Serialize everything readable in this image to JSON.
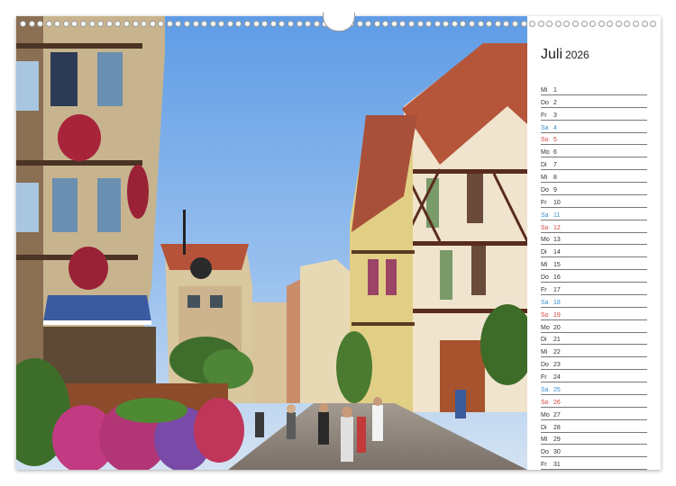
{
  "calendar": {
    "month": "Juli",
    "year": "2026",
    "days": [
      {
        "dow": "Mi",
        "num": "1",
        "type": "weekday"
      },
      {
        "dow": "Do",
        "num": "2",
        "type": "weekday"
      },
      {
        "dow": "Fr",
        "num": "3",
        "type": "weekday"
      },
      {
        "dow": "Sa",
        "num": "4",
        "type": "sa"
      },
      {
        "dow": "So",
        "num": "5",
        "type": "so"
      },
      {
        "dow": "Mo",
        "num": "6",
        "type": "weekday"
      },
      {
        "dow": "Di",
        "num": "7",
        "type": "weekday"
      },
      {
        "dow": "Mi",
        "num": "8",
        "type": "weekday"
      },
      {
        "dow": "Do",
        "num": "9",
        "type": "weekday"
      },
      {
        "dow": "Fr",
        "num": "10",
        "type": "weekday"
      },
      {
        "dow": "Sa",
        "num": "11",
        "type": "sa"
      },
      {
        "dow": "So",
        "num": "12",
        "type": "so"
      },
      {
        "dow": "Mo",
        "num": "13",
        "type": "weekday"
      },
      {
        "dow": "Di",
        "num": "14",
        "type": "weekday"
      },
      {
        "dow": "Mi",
        "num": "15",
        "type": "weekday"
      },
      {
        "dow": "Do",
        "num": "16",
        "type": "weekday"
      },
      {
        "dow": "Fr",
        "num": "17",
        "type": "weekday"
      },
      {
        "dow": "Sa",
        "num": "18",
        "type": "sa"
      },
      {
        "dow": "So",
        "num": "19",
        "type": "so"
      },
      {
        "dow": "Mo",
        "num": "20",
        "type": "weekday"
      },
      {
        "dow": "Di",
        "num": "21",
        "type": "weekday"
      },
      {
        "dow": "Mi",
        "num": "22",
        "type": "weekday"
      },
      {
        "dow": "Do",
        "num": "23",
        "type": "weekday"
      },
      {
        "dow": "Fr",
        "num": "24",
        "type": "weekday"
      },
      {
        "dow": "Sa",
        "num": "25",
        "type": "sa"
      },
      {
        "dow": "So",
        "num": "26",
        "type": "so"
      },
      {
        "dow": "Mo",
        "num": "27",
        "type": "weekday"
      },
      {
        "dow": "Di",
        "num": "28",
        "type": "weekday"
      },
      {
        "dow": "Mi",
        "num": "29",
        "type": "weekday"
      },
      {
        "dow": "Do",
        "num": "30",
        "type": "weekday"
      },
      {
        "dow": "Fr",
        "num": "31",
        "type": "weekday"
      }
    ]
  },
  "colors": {
    "saturday": "#3a8fd0",
    "sunday": "#d0443a",
    "sky": "#7aaee6"
  },
  "photo": {
    "subject_icon": "half-timbered-street-photo"
  }
}
